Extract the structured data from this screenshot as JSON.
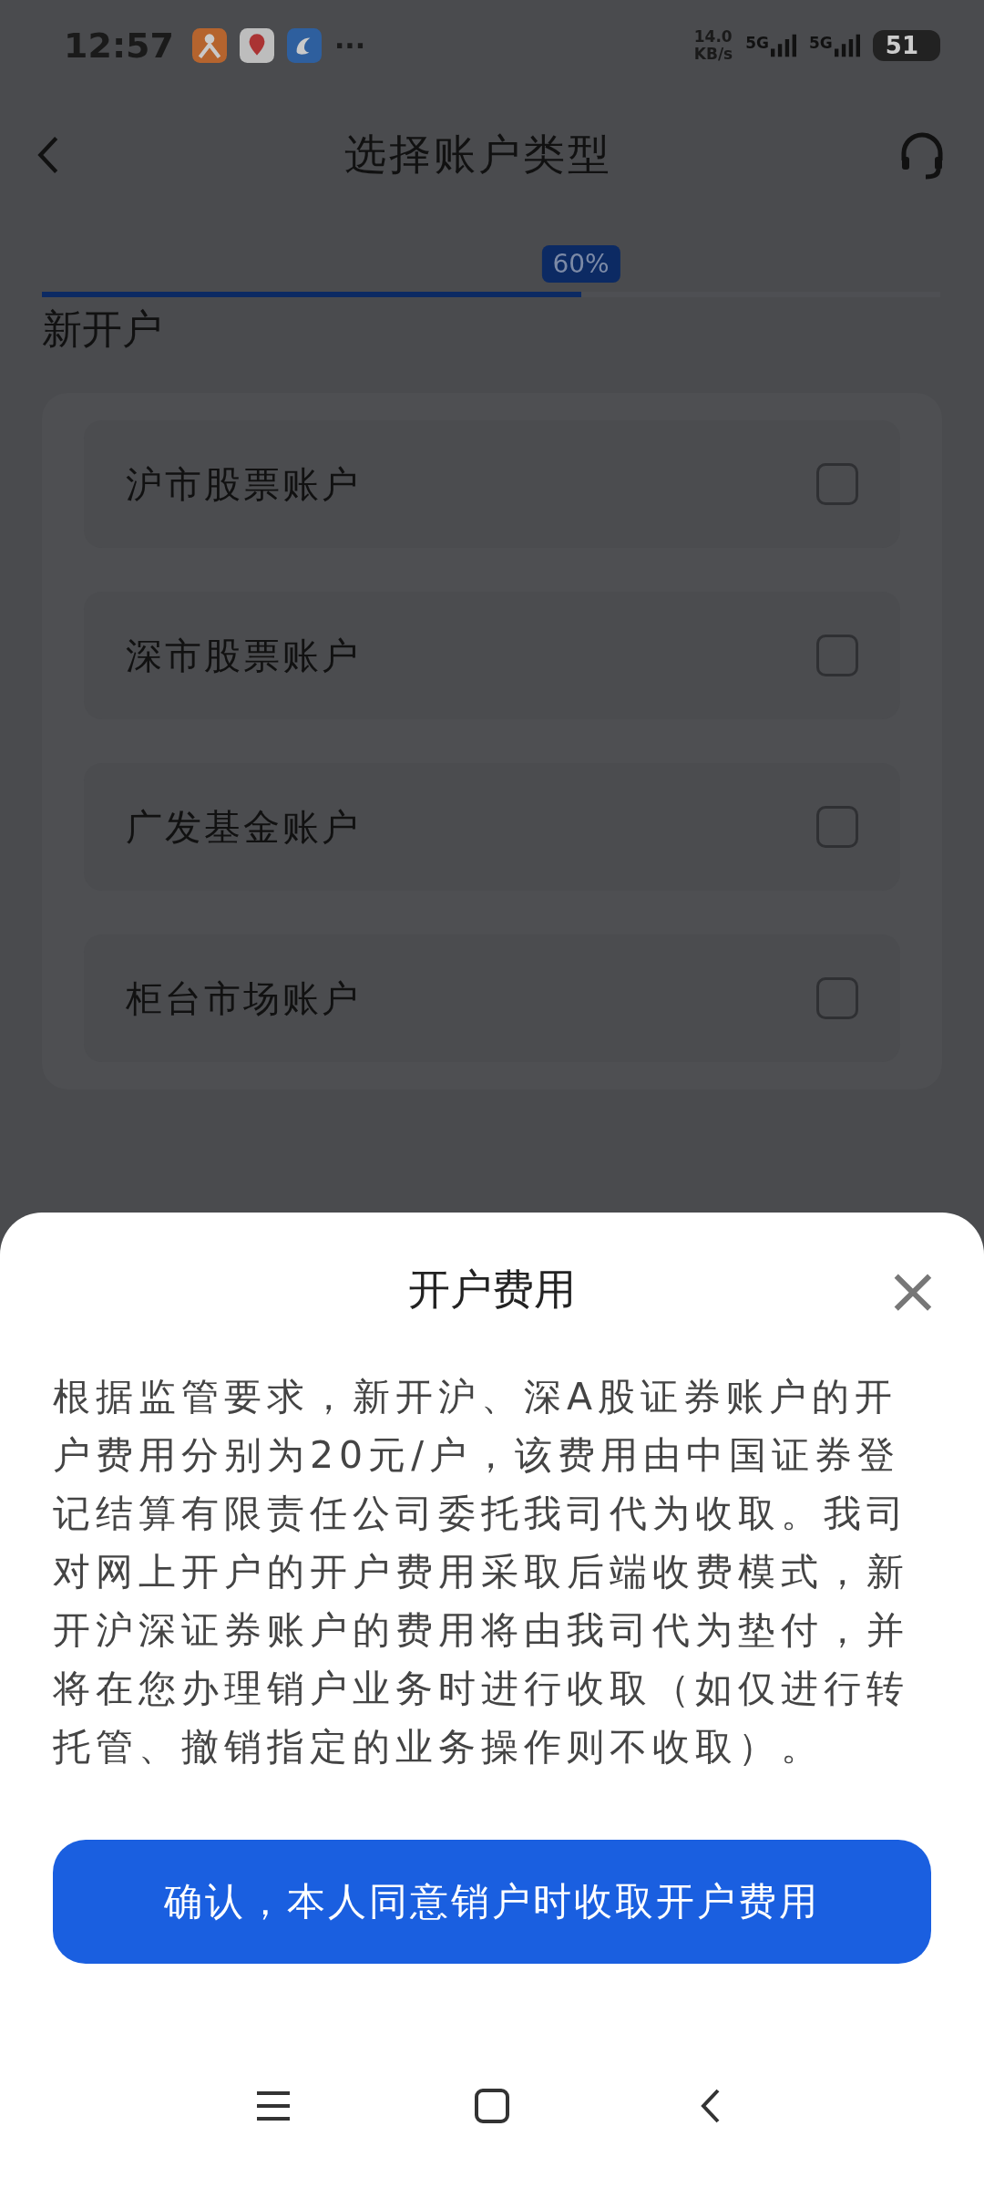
{
  "status_bar": {
    "time": "12:57",
    "more": "···",
    "speed_value": "14.0",
    "speed_unit": "KB/s",
    "networks": [
      "5G",
      "5G"
    ],
    "battery": "51"
  },
  "header": {
    "title": "选择账户类型"
  },
  "progress": {
    "level": 0.6,
    "label": "60%"
  },
  "section": {
    "title": "新开户",
    "items": [
      {
        "label": "沪市股票账户",
        "checked": false
      },
      {
        "label": "深市股票账户",
        "checked": false
      },
      {
        "label": "广发基金账户",
        "checked": false
      },
      {
        "label": "柜台市场账户",
        "checked": false
      }
    ]
  },
  "sheet": {
    "title": "开户费用",
    "close": "×",
    "body": "根据监管要求，新开沪、深A股证券账户的开户费用分别为20元/户，该费用由中国证券登记结算有限责任公司委托我司代为收取。我司对网上开户的开户费用采取后端收费模式，新开沪深证券账户的费用将由我司代为垫付，并将在您办理销户业务时进行收取（如仅进行转托管、撤销指定的业务操作则不收取）。",
    "button": "确认，本人同意销户时收取开户费用"
  }
}
